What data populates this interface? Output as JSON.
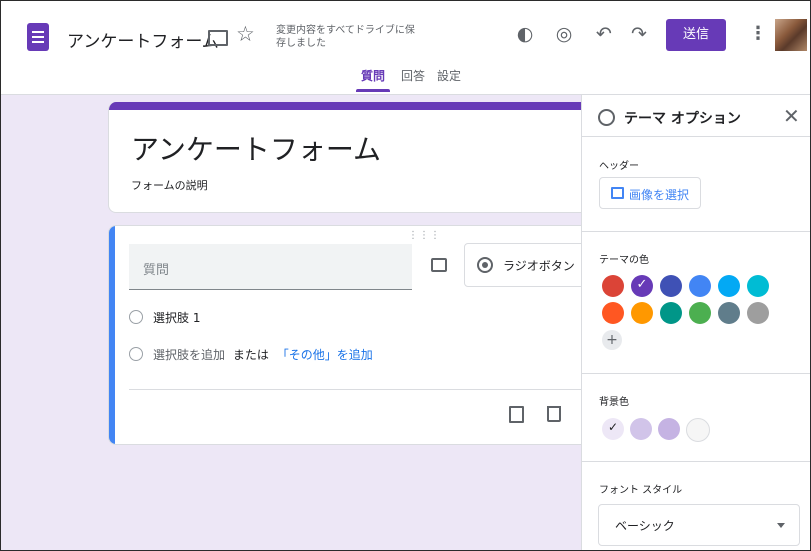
{
  "header": {
    "form_title": "アンケートフォーム",
    "saved_status": "変更内容をすべてドライブに保存しました",
    "send_label": "送信"
  },
  "tabs": [
    {
      "label": "質問",
      "active": true
    },
    {
      "label": "回答",
      "active": false
    },
    {
      "label": "設定",
      "active": false
    }
  ],
  "form": {
    "title": "アンケートフォーム",
    "description": "フォームの説明"
  },
  "question": {
    "placeholder": "質問",
    "type_label": "ラジオボタン",
    "option1": "選択肢 1",
    "add_option": "選択肢を追加",
    "or_text": "または",
    "add_other": "「その他」を追加"
  },
  "theme_panel": {
    "title": "テーマ オプション",
    "header_label": "ヘッダー",
    "select_image": "画像を選択",
    "theme_color_label": "テーマの色",
    "theme_colors": [
      "#db4437",
      "#673ab7",
      "#3f51b5",
      "#4285f4",
      "#03a9f4",
      "#00bcd4",
      "#ff5722",
      "#ff9800",
      "#009688",
      "#4caf50",
      "#607d8b",
      "#9e9e9e"
    ],
    "selected_theme_color": "#673ab7",
    "bg_color_label": "背景色",
    "bg_colors": [
      "#ede7f6",
      "#d1c4e9",
      "#c5b3e3",
      "#f6f6f6"
    ],
    "selected_bg_color": "#ede7f6",
    "font_style_label": "フォント スタイル",
    "font_style_value": "ベーシック"
  },
  "accent_color": "#673ab7"
}
